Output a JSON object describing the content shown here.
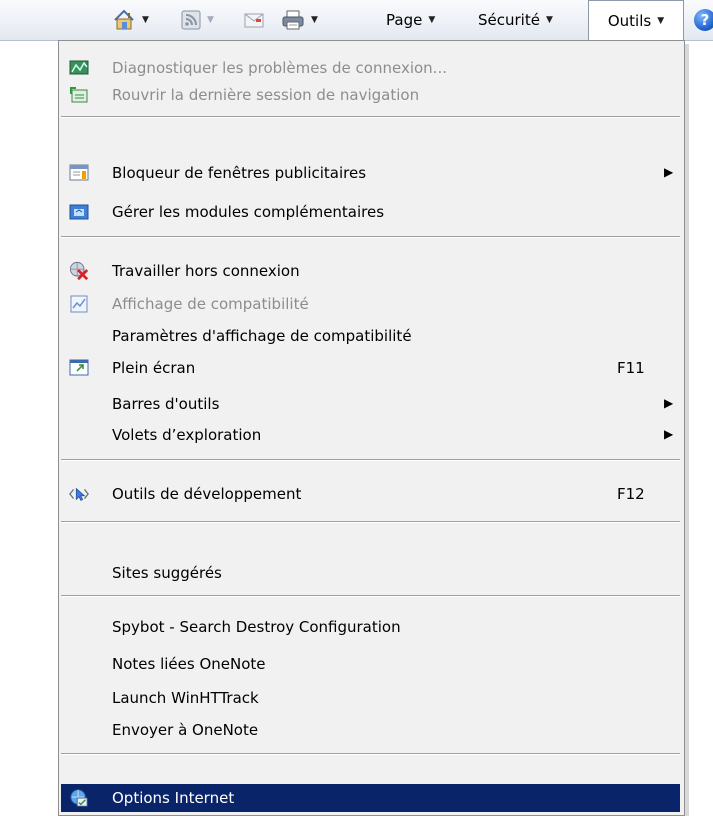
{
  "toolbar": {
    "page_label": "Page",
    "security_label": "Sécurité",
    "tools_label": "Outils",
    "help_glyph": "?"
  },
  "menu": {
    "items": [
      {
        "label": "Diagnostiquer les problèmes de connexion...",
        "icon": "network-diagnose-icon",
        "disabled": true
      },
      {
        "label": "Rouvrir la dernière session de navigation",
        "icon": "reopen-session-icon",
        "disabled": true
      },
      {
        "label": "Bloqueur de fenêtres publicitaires",
        "icon": "popup-blocker-icon",
        "submenu": true
      },
      {
        "label": "Gérer les modules complémentaires",
        "icon": "manage-addons-icon"
      },
      {
        "label": "Travailler hors connexion",
        "icon": "work-offline-icon"
      },
      {
        "label": "Affichage de compatibilité",
        "icon": "compatibility-view-icon",
        "disabled": true
      },
      {
        "label": "Paramètres d'affichage de compatibilité"
      },
      {
        "label": "Plein écran",
        "icon": "fullscreen-icon",
        "shortcut": "F11"
      },
      {
        "label": "Barres d'outils",
        "submenu": true
      },
      {
        "label": "Volets d’exploration",
        "submenu": true
      },
      {
        "label": "Outils de développement",
        "icon": "developer-tools-icon",
        "shortcut": "F12"
      },
      {
        "label": "Sites suggérés"
      },
      {
        "label": "Spybot - Search  Destroy Configuration"
      },
      {
        "label": "Notes liées OneNote"
      },
      {
        "label": "Launch WinHTTrack"
      },
      {
        "label": "Envoyer à OneNote"
      },
      {
        "label": "Options Internet",
        "icon": "internet-options-icon",
        "selected": true
      }
    ]
  },
  "colors": {
    "selection_bg": "#0a246a",
    "menu_bg": "#f1f1f1",
    "disabled_text": "#8d8d8d"
  }
}
